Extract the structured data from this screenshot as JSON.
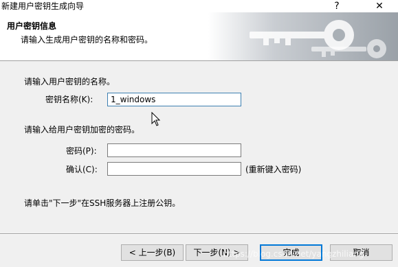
{
  "window": {
    "title": "新建用户密钥生成向导",
    "help_glyph": "?",
    "close_glyph": "✕"
  },
  "header": {
    "title": "用户密钥信息",
    "subtitle": "请输入生成用户密钥的名称和密码。",
    "banner_icon": "keys-banner-icon"
  },
  "form": {
    "name_prompt": "请输入用户密钥的名称。",
    "name_label": "密钥名称(K):",
    "name_value": "1_windows",
    "pw_prompt": "请输入给用户密钥加密的密码。",
    "pw_label": "密码(P):",
    "pw_value": "",
    "confirm_label": "确认(C):",
    "confirm_value": "",
    "confirm_hint": "(重新键入密码)",
    "footer_note": "请单击\"下一步\"在SSH服务器上注册公钥。"
  },
  "buttons": {
    "back": "< 上一步(B)",
    "next": "下一步(N) >",
    "finish": "完成",
    "cancel": "取消"
  },
  "watermark": "https://blog.csdn.net/yangzhiliang"
}
